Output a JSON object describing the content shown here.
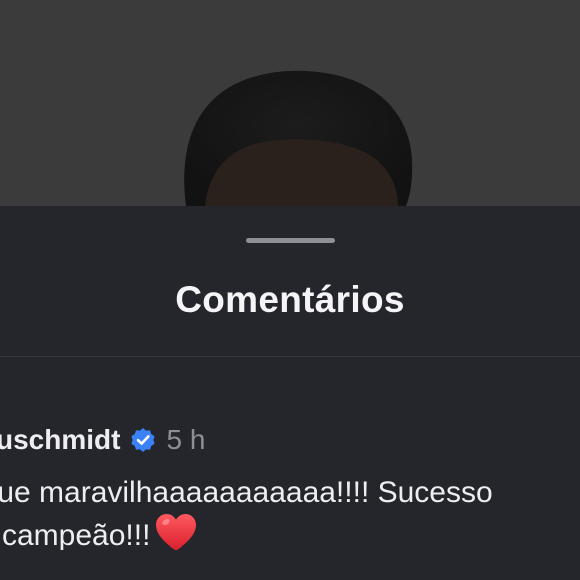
{
  "photo": {
    "description_icon": "person-photo"
  },
  "sheet": {
    "title": "Comentários"
  },
  "comment": {
    "username": "uschmidt",
    "verified_icon": "verified-badge-icon",
    "timestamp": "5 h",
    "line1": "Que maravilhaaaaaaaaaaa!!!! Sucesso",
    "line2": "campeão!!!",
    "emoji": "heart-icon"
  },
  "colors": {
    "sheet_bg": "#24262b",
    "text": "#eeeef0",
    "muted": "#8c8f96",
    "verified": "#3b82f6",
    "heart": "#e8303e"
  }
}
